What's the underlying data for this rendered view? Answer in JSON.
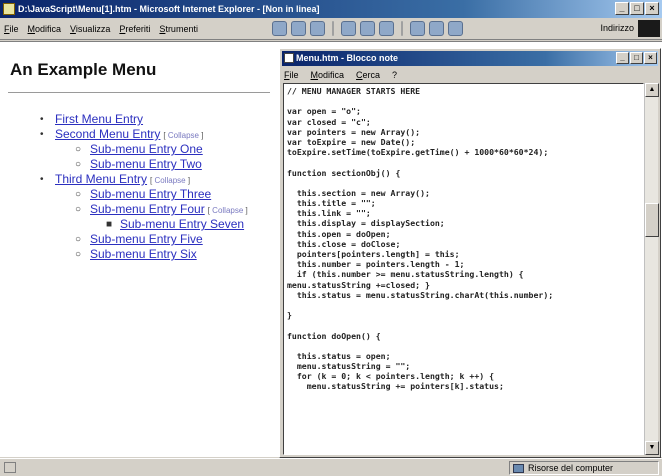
{
  "ie": {
    "title": "D:\\JavaScript\\Menu[1].htm - Microsoft Internet Explorer - [Non in linea]",
    "menu": [
      "File",
      "Modifica",
      "Visualizza",
      "Preferiti",
      "Strumenti"
    ],
    "address_label": "Indirizzo"
  },
  "page": {
    "heading": "An Example Menu",
    "menu": [
      {
        "level": 1,
        "label": "First Menu Entry",
        "collapse": ""
      },
      {
        "level": 1,
        "label": "Second Menu Entry",
        "collapse": "Collapse"
      },
      {
        "level": 2,
        "label": "Sub-menu Entry One",
        "collapse": ""
      },
      {
        "level": 2,
        "label": "Sub-menu Entry Two",
        "collapse": ""
      },
      {
        "level": 1,
        "label": "Third Menu Entry",
        "collapse": "Collapse"
      },
      {
        "level": 2,
        "label": "Sub-menu Entry Three",
        "collapse": ""
      },
      {
        "level": 2,
        "label": "Sub-menu Entry Four",
        "collapse": "Collapse"
      },
      {
        "level": 3,
        "label": "Sub-menu Entry Seven",
        "collapse": ""
      },
      {
        "level": 2,
        "label": "Sub-menu Entry Five",
        "collapse": ""
      },
      {
        "level": 2,
        "label": "Sub-menu Entry Six",
        "collapse": ""
      }
    ]
  },
  "notepad": {
    "title": "Menu.htm - Blocco note",
    "menu": [
      "File",
      "Modifica",
      "Cerca",
      "?"
    ],
    "code": [
      "// MENU MANAGER STARTS HERE",
      "",
      "var open = \"o\";",
      "var closed = \"c\";",
      "var pointers = new Array();",
      "var toExpire = new Date();",
      "toExpire.setTime(toExpire.getTime() + 1000*60*60*24);",
      "",
      "function sectionObj() {",
      "",
      "  this.section = new Array();",
      "  this.title = \"\";",
      "  this.link = \"\";",
      "  this.display = displaySection;",
      "  this.open = doOpen;",
      "  this.close = doClose;",
      "  pointers[pointers.length] = this;",
      "  this.number = pointers.length - 1;",
      "  if (this.number >= menu.statusString.length) {",
      "menu.statusString +=closed; }",
      "  this.status = menu.statusString.charAt(this.number);",
      "",
      "}",
      "",
      "function doOpen() {",
      "",
      "  this.status = open;",
      "  menu.statusString = \"\";",
      "  for (k = 0; k < pointers.length; k ++) {",
      "    menu.statusString += pointers[k].status;"
    ]
  },
  "status": {
    "zone": "Risorse del computer"
  }
}
